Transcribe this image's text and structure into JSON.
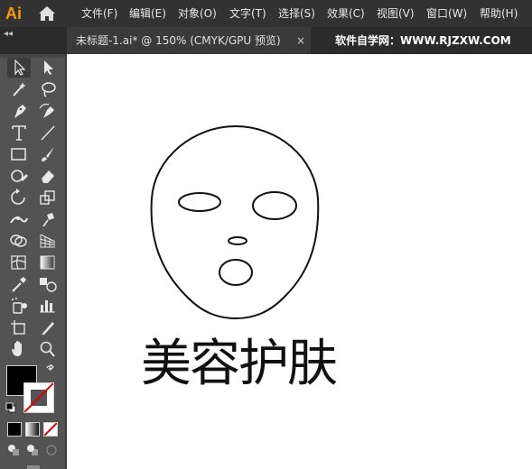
{
  "app": {
    "logo": "Ai"
  },
  "menu": [
    "文件(F)",
    "编辑(E)",
    "对象(O)",
    "文字(T)",
    "选择(S)",
    "效果(C)",
    "视图(V)",
    "窗口(W)",
    "帮助(H)"
  ],
  "tab": {
    "title": "未标题-1.ai* @ 150% (CMYK/GPU 预览)",
    "close": "×"
  },
  "watermark": "软件自学网：WWW.RJZXW.COM",
  "panel": {
    "collapse": "◂◂"
  },
  "tools": [
    "selection-tool",
    "direct-selection-tool",
    "magic-wand-tool",
    "lasso-tool",
    "pen-tool",
    "curvature-tool",
    "type-tool",
    "line-segment-tool",
    "rectangle-tool",
    "paintbrush-tool",
    "shaper-tool",
    "eraser-tool",
    "rotate-tool",
    "scale-tool",
    "width-tool",
    "puppet-warp-tool",
    "shape-builder-tool",
    "perspective-grid-tool",
    "mesh-tool",
    "gradient-tool",
    "eyedropper-tool",
    "blend-tool",
    "symbol-sprayer-tool",
    "column-graph-tool",
    "artboard-tool",
    "slice-tool",
    "hand-tool",
    "zoom-tool"
  ],
  "colors": {
    "fill": "#000000",
    "stroke": "none",
    "accent": "#ff9a00"
  },
  "canvas": {
    "text": "美容护肤"
  }
}
